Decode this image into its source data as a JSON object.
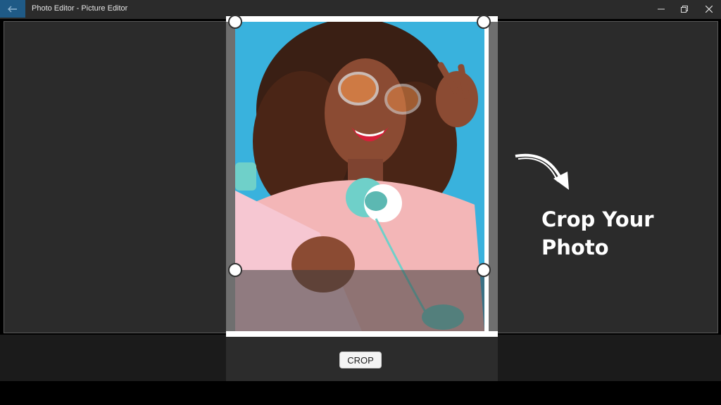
{
  "window": {
    "title": "Photo Editor - Picture Editor",
    "back_icon": "back-arrow-icon",
    "controls": [
      "minimize-icon",
      "restore-icon",
      "close-icon"
    ]
  },
  "toolbar": {
    "crop_label": "CROP"
  },
  "promo": {
    "line1": "Crop Your",
    "line2": "Photo",
    "arrow_icon": "curved-arrow-icon"
  },
  "colors": {
    "titlebar": "#2b2b2b",
    "accent": "#1f5a86",
    "canvas": "#2b2b2b",
    "photo_bg": "#39b2dd",
    "shirt": "#f3b6b7",
    "skin": "#8b4b33",
    "hair": "#3a1f14",
    "headphones": "#6fd0c9"
  }
}
